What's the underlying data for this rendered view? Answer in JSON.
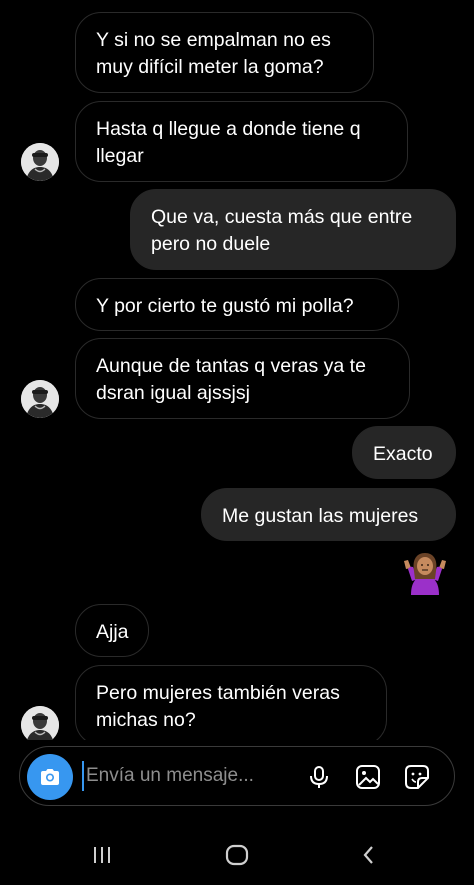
{
  "conversation": {
    "messages": [
      {
        "direction": "incoming",
        "text": "Y si no se empalman no es\nmuy difícil meter la goma?"
      },
      {
        "direction": "incoming",
        "text": "Hasta q llegue a donde tiene q\nllegar"
      },
      {
        "direction": "outgoing",
        "text": "Que va, cuesta más que entre\npero no duele"
      },
      {
        "direction": "incoming",
        "text": "Y por cierto te gustó mi polla?"
      },
      {
        "direction": "incoming",
        "text": "Aunque de tantas q veras ya te\ndsran igual ajssjsj"
      },
      {
        "direction": "outgoing",
        "text": "Exacto"
      },
      {
        "direction": "outgoing",
        "text": "Me gustan las mujeres"
      },
      {
        "direction": "outgoing",
        "emoji": "person-shrugging"
      },
      {
        "direction": "incoming",
        "text": "Ajja"
      },
      {
        "direction": "incoming",
        "text": "Pero mujeres también veras\nmichas no?"
      }
    ]
  },
  "composer": {
    "placeholder": "Envía un mensaje...",
    "icons": [
      "camera-icon",
      "microphone-icon",
      "gallery-icon",
      "sticker-icon"
    ],
    "accent_color": "#3797f0"
  },
  "navigation_bar": {
    "icons": [
      "recent-apps-icon",
      "home-icon",
      "back-icon"
    ]
  },
  "theme": {
    "background": "#000000",
    "outgoing_bubble": "#262626",
    "incoming_border": "#2a2a2a"
  }
}
